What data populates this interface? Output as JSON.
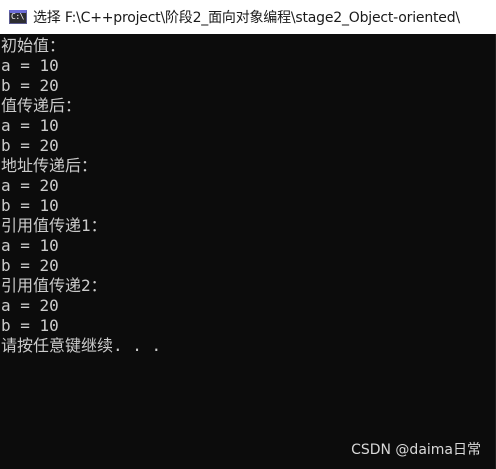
{
  "window": {
    "title": "选择 F:\\C++project\\阶段2_面向对象编程\\stage2_Object-oriented\\",
    "app_icon": "console-app-icon",
    "app_icon_text": "C:\\"
  },
  "console": {
    "lines": [
      "初始值：",
      "a = 10",
      "b = 20",
      "值传递后：",
      "a = 10",
      "b = 20",
      "地址传递后：",
      "a = 20",
      "b = 10",
      "引用值传递1：",
      "a = 10",
      "b = 20",
      "引用值传递2：",
      "a = 20",
      "b = 10",
      "请按任意键继续. . ."
    ]
  },
  "watermark": {
    "text": "CSDN @daima日常"
  },
  "colors": {
    "background": "#0c0c0c",
    "text": "#cccccc",
    "titlebar": "#ffffff"
  }
}
